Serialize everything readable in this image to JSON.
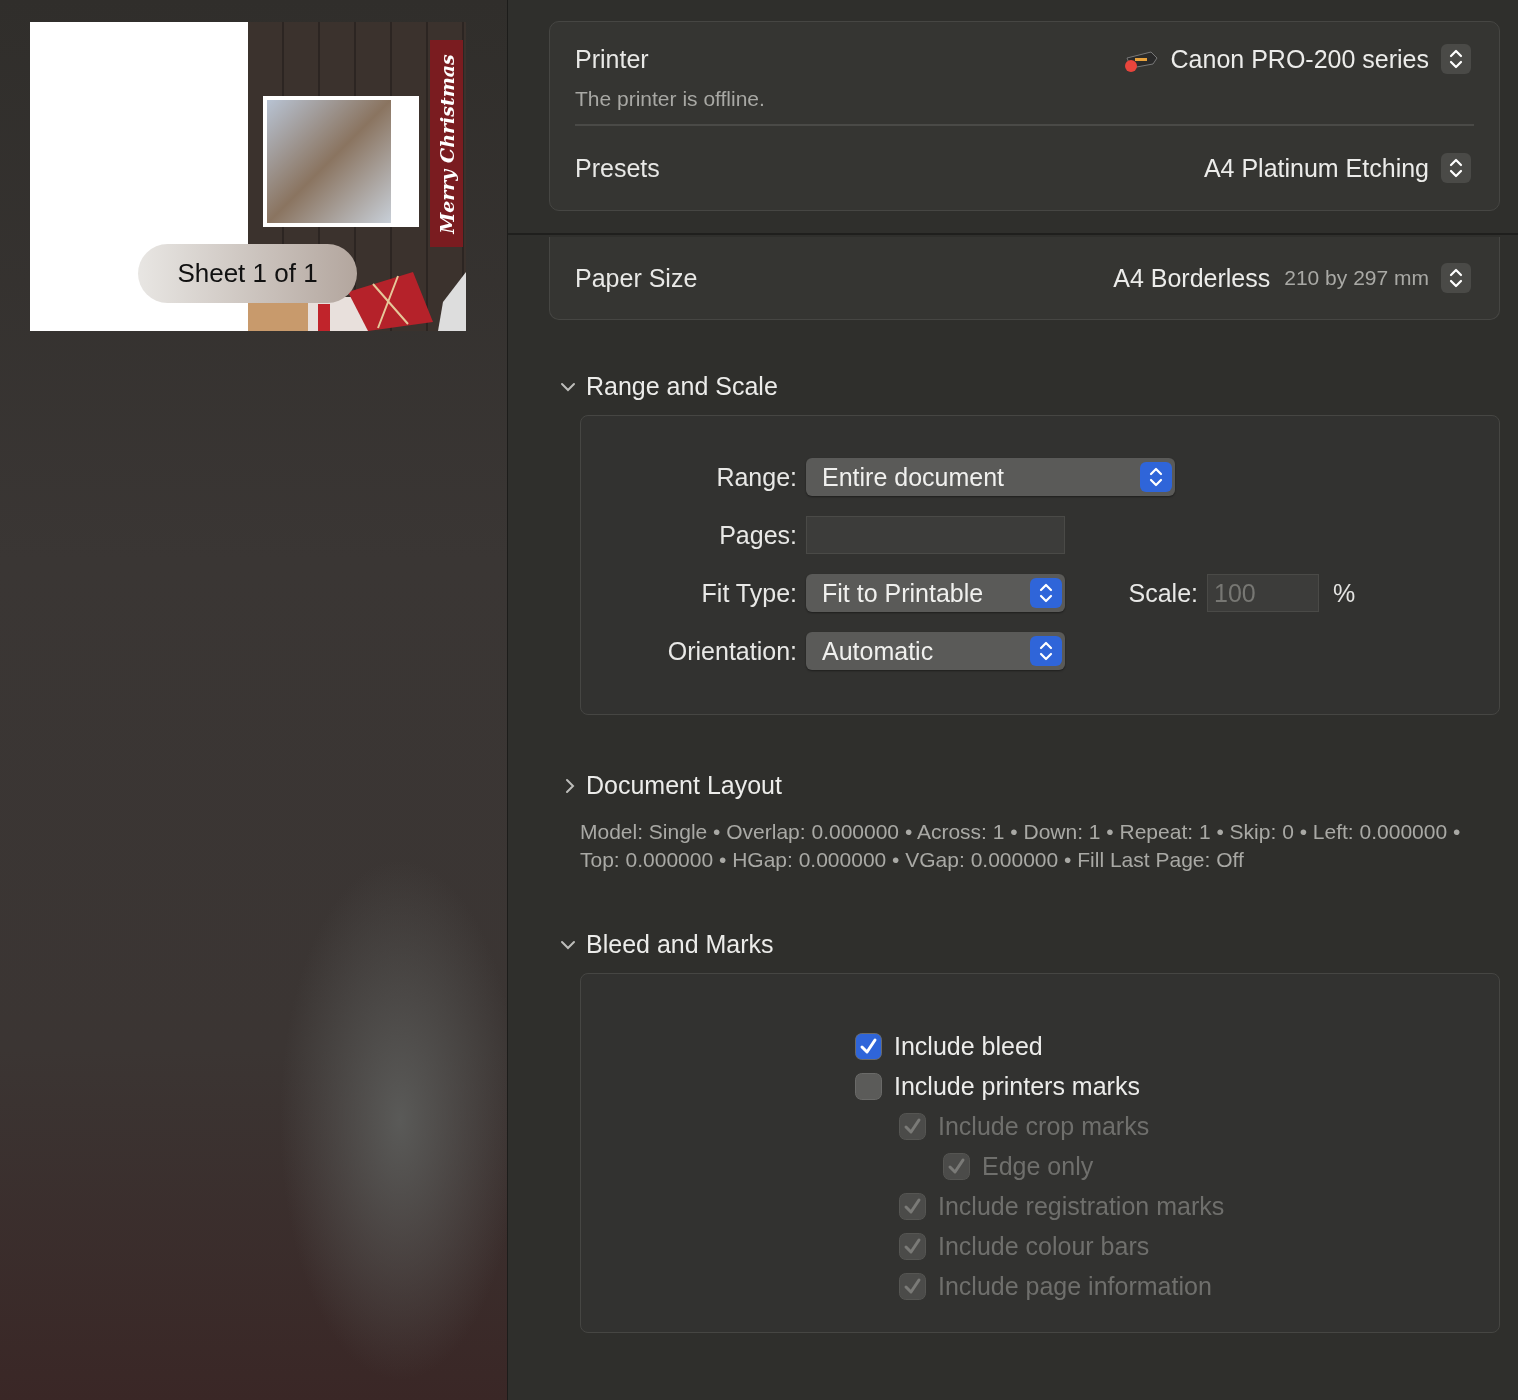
{
  "preview": {
    "card_text": "Merry Christmas",
    "sheet_label": "Sheet 1 of 1"
  },
  "printer": {
    "label": "Printer",
    "value": "Canon PRO-200 series",
    "status": "The printer is offline."
  },
  "presets": {
    "label": "Presets",
    "value": "A4 Platinum Etching"
  },
  "paper_size": {
    "label": "Paper Size",
    "value": "A4 Borderless",
    "dimensions": "210 by 297 mm"
  },
  "range_and_scale": {
    "title": "Range and Scale",
    "expanded": true,
    "range": {
      "label": "Range:",
      "value": "Entire document"
    },
    "pages": {
      "label": "Pages:"
    },
    "fit_type": {
      "label": "Fit Type:",
      "value": "Fit to Printable"
    },
    "scale": {
      "label": "Scale:",
      "value": "100",
      "unit": "%",
      "disabled": true
    },
    "orientation": {
      "label": "Orientation:",
      "value": "Automatic"
    }
  },
  "document_layout": {
    "title": "Document Layout",
    "expanded": false,
    "summary": "Model: Single • Overlap: 0.000000 • Across: 1 • Down: 1 • Repeat: 1 • Skip: 0 • Left: 0.000000 • Top: 0.000000 • HGap: 0.000000 • VGap: 0.000000 • Fill Last Page: Off"
  },
  "bleed_and_marks": {
    "title": "Bleed and Marks",
    "expanded": true,
    "checkboxes": [
      {
        "label": "Include bleed",
        "checked": true,
        "disabled": false
      },
      {
        "label": "Include printers marks",
        "checked": false,
        "disabled": false,
        "children": [
          {
            "label": "Include crop marks",
            "checked": true,
            "disabled": true,
            "children": [
              {
                "label": "Edge only",
                "checked": true,
                "disabled": true
              }
            ]
          },
          {
            "label": "Include registration marks",
            "checked": true,
            "disabled": true
          },
          {
            "label": "Include colour bars",
            "checked": true,
            "disabled": true
          },
          {
            "label": "Include page information",
            "checked": true,
            "disabled": true
          }
        ]
      }
    ]
  }
}
